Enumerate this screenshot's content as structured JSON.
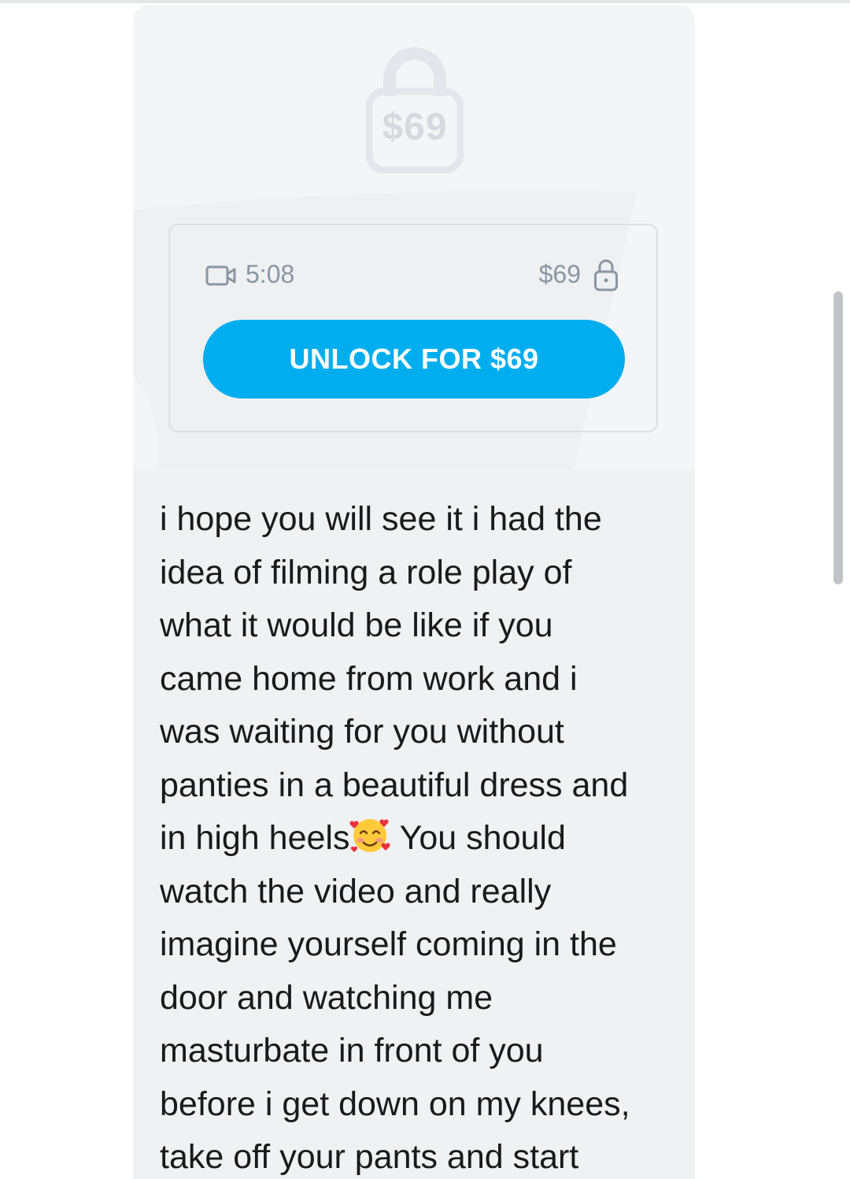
{
  "post": {
    "lock_overlay_price": "$69",
    "video_duration": "5:08",
    "price": "$69",
    "unlock_button_label": "UNLOCK FOR $69",
    "message_lines": [
      "i hope you will see it i had the",
      "idea of filming a role play of",
      "what it would be like if you",
      "came home from work and i",
      "was waiting for you without",
      "panties in a beautiful dress and",
      "in high heels",
      " You should",
      "watch the video and really",
      "imagine yourself coming in the",
      "door and watching me",
      "masturbate in front of you",
      "before i get down on my knees,",
      "take off your pants and start"
    ],
    "emoji": "smiling-face-with-hearts"
  },
  "colors": {
    "accent": "#00aeef",
    "muted_text": "#8a96a3",
    "card_bg": "#f0f1f3"
  },
  "icons": [
    "video-camera-icon",
    "lock-icon"
  ]
}
